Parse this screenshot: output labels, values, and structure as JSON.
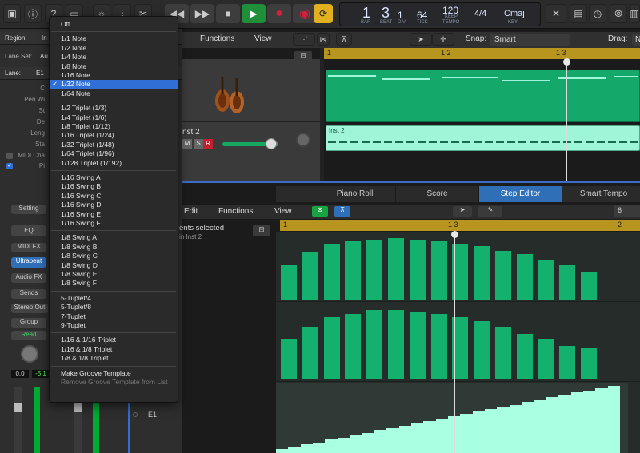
{
  "toolbar": {
    "transport_icons": [
      "rewind-icon",
      "forward-icon",
      "stop-icon",
      "play-icon",
      "record-icon",
      "record-alt-icon",
      "cycle-icon"
    ],
    "lcd": {
      "bar": "1",
      "beat": "3",
      "div": "1",
      "tick": "64",
      "tempo": "120",
      "keep_label": "KEEP",
      "time_sig": "4/4",
      "key": "Cmaj",
      "labels": {
        "bar": "BAR",
        "beat": "BEAT",
        "div": "DIV",
        "tick": "TICK",
        "tempo": "TEMPO",
        "key": "KEY"
      }
    },
    "accent_play": "#1f8f3a",
    "accent_record": "#d4203a",
    "accent_cycle": "#e0b020"
  },
  "left": {
    "region_label": "Region:",
    "region_value": "In",
    "lane_set_label": "Lane Set:",
    "lane_set_value": "Au",
    "lane_label": "Lane:",
    "lane_value": "E1",
    "inspector_rows": [
      "C",
      "Pen Wi",
      "St",
      "De",
      "Leng",
      "Sta",
      "MIDI Cha",
      "Pi"
    ],
    "setting_btn": "Setting",
    "eq_btn": "EQ",
    "midi_fx_btn": "MIDI FX",
    "ultrabeat_btn": "Ultrabeat",
    "audio_fx_btn": "Audio FX",
    "sends_btn": "Sends",
    "stereo_out": "Stereo Out",
    "group_btn": "Group",
    "read_btn": "Read",
    "vol_left": "0.0",
    "vol_right": "-5.1",
    "lane_name": "E1"
  },
  "tracks": {
    "menu": [
      "Functions",
      "View"
    ],
    "snap_label": "Snap:",
    "snap_value": "Smart",
    "drag_label": "Drag:",
    "drag_value": "No Over",
    "ruler": [
      "1",
      "1 2",
      "1 3"
    ],
    "track2_name": "nst 2",
    "mute": "M",
    "solo": "S",
    "rec": "R",
    "region2_name": "Inst 2"
  },
  "editor": {
    "tabs": [
      "Piano Roll",
      "Score",
      "Step Editor",
      "Smart Tempo"
    ],
    "active_tab": "Step Editor",
    "menu": [
      "Edit",
      "Functions",
      "View"
    ],
    "selection_title": "ents selected",
    "selection_sub": "in Inst 2",
    "ruler": [
      "1",
      "1 3",
      "2"
    ],
    "zoom": "6"
  },
  "dropdown": {
    "items": [
      {
        "label": "Off"
      },
      {
        "sep": true
      },
      {
        "label": "1/1 Note"
      },
      {
        "label": "1/2 Note"
      },
      {
        "label": "1/4 Note"
      },
      {
        "label": "1/8 Note"
      },
      {
        "label": "1/16 Note"
      },
      {
        "label": "1/32 Note",
        "selected": true
      },
      {
        "label": "1/64 Note"
      },
      {
        "sep": true
      },
      {
        "label": "1/2 Triplet (1/3)"
      },
      {
        "label": "1/4 Triplet (1/6)"
      },
      {
        "label": "1/8 Triplet (1/12)"
      },
      {
        "label": "1/16 Triplet (1/24)"
      },
      {
        "label": "1/32 Triplet (1/48)"
      },
      {
        "label": "1/64 Triplet (1/96)"
      },
      {
        "label": "1/128 Triplet (1/192)"
      },
      {
        "sep": true
      },
      {
        "label": "1/16 Swing A"
      },
      {
        "label": "1/16 Swing B"
      },
      {
        "label": "1/16 Swing C"
      },
      {
        "label": "1/16 Swing D"
      },
      {
        "label": "1/16 Swing E"
      },
      {
        "label": "1/16 Swing F"
      },
      {
        "sep": true
      },
      {
        "label": "1/8 Swing A"
      },
      {
        "label": "1/8 Swing B"
      },
      {
        "label": "1/8 Swing C"
      },
      {
        "label": "1/8 Swing D"
      },
      {
        "label": "1/8 Swing E"
      },
      {
        "label": "1/8 Swing F"
      },
      {
        "sep": true
      },
      {
        "label": "5-Tuplet/4"
      },
      {
        "label": "5-Tuplet/8"
      },
      {
        "label": "7-Tuplet"
      },
      {
        "label": "9-Tuplet"
      },
      {
        "sep": true
      },
      {
        "label": "1/16 & 1/16 Triplet"
      },
      {
        "label": "1/16 & 1/8 Triplet"
      },
      {
        "label": "1/8 & 1/8 Triplet"
      },
      {
        "sep": true
      },
      {
        "label": "Make Groove Template"
      },
      {
        "label": "Remove Groove Template from List",
        "disabled": true
      }
    ]
  },
  "step_editor": {
    "row1_levels": [
      0.55,
      0.75,
      0.88,
      0.92,
      0.95,
      0.98,
      0.95,
      0.92,
      0.88,
      0.85,
      0.78,
      0.72,
      0.62,
      0.55,
      0.45
    ],
    "row2_levels": [
      0.55,
      0.72,
      0.85,
      0.9,
      0.95,
      0.95,
      0.92,
      0.9,
      0.85,
      0.8,
      0.72,
      0.62,
      0.55,
      0.45,
      0.42
    ],
    "velocity_ramp": [
      0.06,
      0.1,
      0.13,
      0.16,
      0.2,
      0.23,
      0.27,
      0.3,
      0.34,
      0.37,
      0.41,
      0.44,
      0.48,
      0.51,
      0.55,
      0.58,
      0.62,
      0.65,
      0.69,
      0.72,
      0.76,
      0.79,
      0.83,
      0.86,
      0.9,
      0.93,
      0.97,
      1.0
    ]
  }
}
